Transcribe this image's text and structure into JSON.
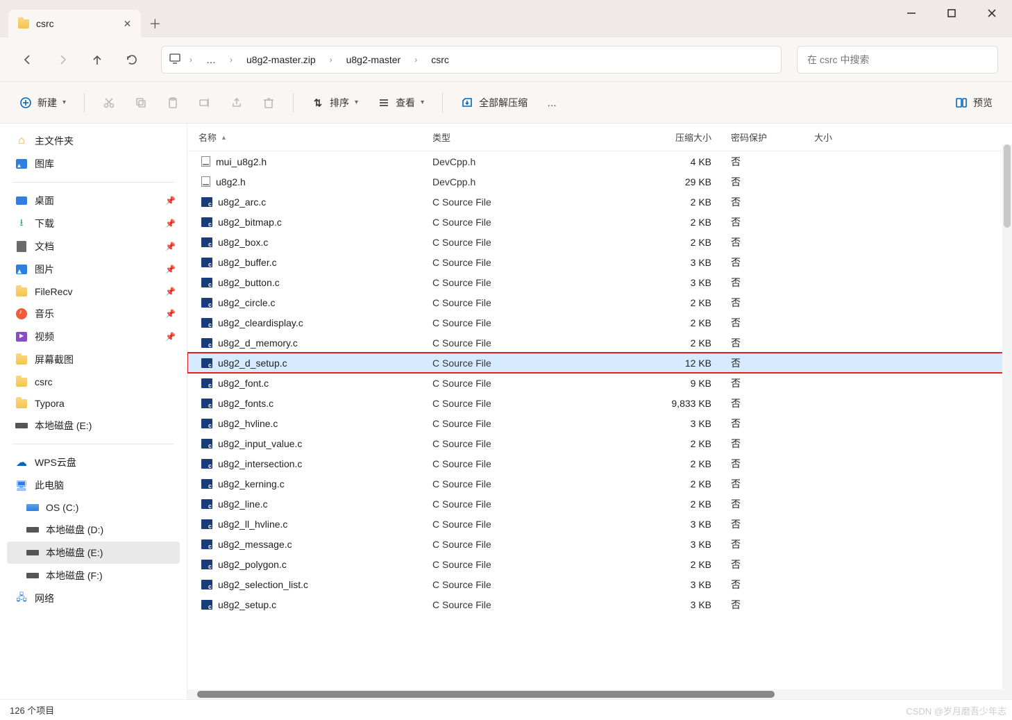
{
  "window": {
    "tab_title": "csrc"
  },
  "nav": {
    "crumbs": [
      "u8g2-master.zip",
      "u8g2-master",
      "csrc"
    ],
    "search_placeholder": "在 csrc 中搜索"
  },
  "toolbar": {
    "new_label": "新建",
    "sort_label": "排序",
    "view_label": "查看",
    "extract_label": "全部解压缩",
    "preview_label": "预览"
  },
  "sidebar": {
    "home": "主文件夹",
    "gallery": "图库",
    "quick": [
      {
        "label": "桌面",
        "icon": "desktop",
        "pin": true
      },
      {
        "label": "下载",
        "icon": "download",
        "pin": true
      },
      {
        "label": "文档",
        "icon": "doc",
        "pin": true
      },
      {
        "label": "图片",
        "icon": "pic",
        "pin": true
      },
      {
        "label": "FileRecv",
        "icon": "folder",
        "pin": true
      },
      {
        "label": "音乐",
        "icon": "music",
        "pin": true
      },
      {
        "label": "视频",
        "icon": "video",
        "pin": true
      },
      {
        "label": "屏幕截图",
        "icon": "folder",
        "pin": false
      },
      {
        "label": "csrc",
        "icon": "folder",
        "pin": false
      },
      {
        "label": "Typora",
        "icon": "folder",
        "pin": false
      },
      {
        "label": "本地磁盘 (E:)",
        "icon": "drive",
        "pin": false
      }
    ],
    "wps": "WPS云盘",
    "thispc": "此电脑",
    "drives": [
      {
        "label": "OS (C:)",
        "icon": "os"
      },
      {
        "label": "本地磁盘 (D:)",
        "icon": "drive"
      },
      {
        "label": "本地磁盘 (E:)",
        "icon": "drive",
        "selected": true
      },
      {
        "label": "本地磁盘 (F:)",
        "icon": "drive"
      }
    ],
    "network": "网络"
  },
  "columns": {
    "name": "名称",
    "type": "类型",
    "csize": "压缩大小",
    "pw": "密码保护",
    "size": "大小"
  },
  "files": [
    {
      "name": "mui_u8g2.h",
      "type": "DevCpp.h",
      "csize": "4 KB",
      "pw": "否",
      "ico": "h"
    },
    {
      "name": "u8g2.h",
      "type": "DevCpp.h",
      "csize": "29 KB",
      "pw": "否",
      "ico": "h"
    },
    {
      "name": "u8g2_arc.c",
      "type": "C Source File",
      "csize": "2 KB",
      "pw": "否",
      "ico": "c"
    },
    {
      "name": "u8g2_bitmap.c",
      "type": "C Source File",
      "csize": "2 KB",
      "pw": "否",
      "ico": "c"
    },
    {
      "name": "u8g2_box.c",
      "type": "C Source File",
      "csize": "2 KB",
      "pw": "否",
      "ico": "c"
    },
    {
      "name": "u8g2_buffer.c",
      "type": "C Source File",
      "csize": "3 KB",
      "pw": "否",
      "ico": "c"
    },
    {
      "name": "u8g2_button.c",
      "type": "C Source File",
      "csize": "3 KB",
      "pw": "否",
      "ico": "c"
    },
    {
      "name": "u8g2_circle.c",
      "type": "C Source File",
      "csize": "2 KB",
      "pw": "否",
      "ico": "c"
    },
    {
      "name": "u8g2_cleardisplay.c",
      "type": "C Source File",
      "csize": "2 KB",
      "pw": "否",
      "ico": "c"
    },
    {
      "name": "u8g2_d_memory.c",
      "type": "C Source File",
      "csize": "2 KB",
      "pw": "否",
      "ico": "c"
    },
    {
      "name": "u8g2_d_setup.c",
      "type": "C Source File",
      "csize": "12 KB",
      "pw": "否",
      "ico": "c",
      "highlight": true,
      "boxed": true
    },
    {
      "name": "u8g2_font.c",
      "type": "C Source File",
      "csize": "9 KB",
      "pw": "否",
      "ico": "c"
    },
    {
      "name": "u8g2_fonts.c",
      "type": "C Source File",
      "csize": "9,833 KB",
      "pw": "否",
      "ico": "c"
    },
    {
      "name": "u8g2_hvline.c",
      "type": "C Source File",
      "csize": "3 KB",
      "pw": "否",
      "ico": "c"
    },
    {
      "name": "u8g2_input_value.c",
      "type": "C Source File",
      "csize": "2 KB",
      "pw": "否",
      "ico": "c"
    },
    {
      "name": "u8g2_intersection.c",
      "type": "C Source File",
      "csize": "2 KB",
      "pw": "否",
      "ico": "c"
    },
    {
      "name": "u8g2_kerning.c",
      "type": "C Source File",
      "csize": "2 KB",
      "pw": "否",
      "ico": "c"
    },
    {
      "name": "u8g2_line.c",
      "type": "C Source File",
      "csize": "2 KB",
      "pw": "否",
      "ico": "c"
    },
    {
      "name": "u8g2_ll_hvline.c",
      "type": "C Source File",
      "csize": "3 KB",
      "pw": "否",
      "ico": "c"
    },
    {
      "name": "u8g2_message.c",
      "type": "C Source File",
      "csize": "3 KB",
      "pw": "否",
      "ico": "c"
    },
    {
      "name": "u8g2_polygon.c",
      "type": "C Source File",
      "csize": "2 KB",
      "pw": "否",
      "ico": "c"
    },
    {
      "name": "u8g2_selection_list.c",
      "type": "C Source File",
      "csize": "3 KB",
      "pw": "否",
      "ico": "c"
    },
    {
      "name": "u8g2_setup.c",
      "type": "C Source File",
      "csize": "3 KB",
      "pw": "否",
      "ico": "c"
    }
  ],
  "status": {
    "count": "126 个项目"
  },
  "watermark": "CSDN @岁月磨吾少年志"
}
